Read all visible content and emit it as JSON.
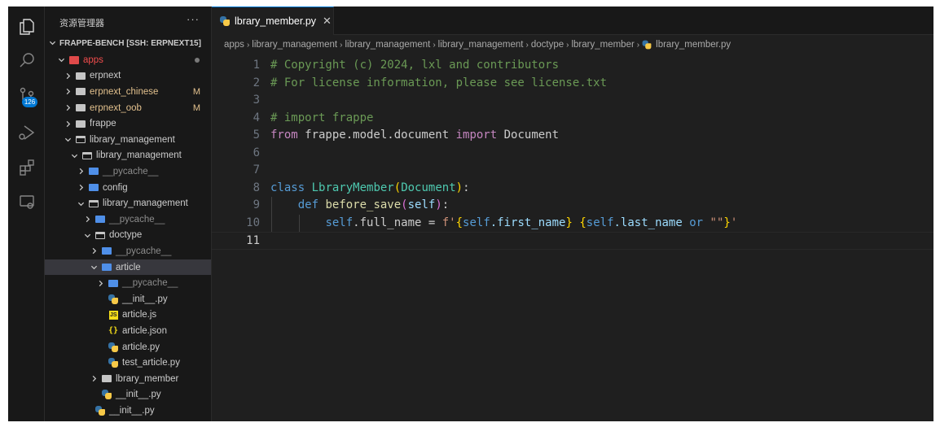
{
  "sidebar": {
    "title": "资源管理器",
    "more": "···",
    "workspace": "FRAPPE-BENCH [SSH: ERPNEXT15]",
    "tree": [
      {
        "label": "apps",
        "depth": 1,
        "kind": "apps",
        "open": true,
        "color": "red",
        "dot": true
      },
      {
        "label": "erpnext",
        "depth": 2,
        "kind": "folder",
        "open": false
      },
      {
        "label": "erpnext_chinese",
        "depth": 2,
        "kind": "folder",
        "open": false,
        "color": "modified",
        "status": "M"
      },
      {
        "label": "erpnext_oob",
        "depth": 2,
        "kind": "folder",
        "open": false,
        "color": "modified",
        "status": "M"
      },
      {
        "label": "frappe",
        "depth": 2,
        "kind": "folder",
        "open": false
      },
      {
        "label": "library_management",
        "depth": 2,
        "kind": "folder",
        "open": true
      },
      {
        "label": "library_management",
        "depth": 3,
        "kind": "folder",
        "open": true
      },
      {
        "label": "__pycache__",
        "depth": 4,
        "kind": "pyfolder",
        "open": false,
        "color": "dim"
      },
      {
        "label": "config",
        "depth": 4,
        "kind": "bluefolder",
        "open": false
      },
      {
        "label": "library_management",
        "depth": 4,
        "kind": "folder",
        "open": true
      },
      {
        "label": "__pycache__",
        "depth": 5,
        "kind": "pyfolder",
        "open": false,
        "color": "dim"
      },
      {
        "label": "doctype",
        "depth": 5,
        "kind": "folder",
        "open": true
      },
      {
        "label": "__pycache__",
        "depth": 6,
        "kind": "pyfolder",
        "open": false,
        "color": "dim"
      },
      {
        "label": "article",
        "depth": 6,
        "kind": "bluefolder",
        "open": true,
        "selected": true
      },
      {
        "label": "__pycache__",
        "depth": 7,
        "kind": "pyfolder",
        "open": false,
        "color": "dim"
      },
      {
        "label": "__init__.py",
        "depth": 7,
        "kind": "py",
        "file": true
      },
      {
        "label": "article.js",
        "depth": 7,
        "kind": "js",
        "file": true
      },
      {
        "label": "article.json",
        "depth": 7,
        "kind": "json",
        "file": true
      },
      {
        "label": "article.py",
        "depth": 7,
        "kind": "py",
        "file": true
      },
      {
        "label": "test_article.py",
        "depth": 7,
        "kind": "py",
        "file": true
      },
      {
        "label": "lbrary_member",
        "depth": 6,
        "kind": "folder",
        "open": false
      },
      {
        "label": "__init__.py",
        "depth": 6,
        "kind": "py",
        "file": true
      },
      {
        "label": "__init__.py",
        "depth": 5,
        "kind": "py",
        "file": true
      }
    ]
  },
  "activity_bar": {
    "scm_badge": "126",
    "icons": [
      "explorer-icon",
      "search-icon",
      "source-control-icon",
      "run-debug-icon",
      "extensions-icon",
      "remote-explorer-icon"
    ]
  },
  "editor": {
    "tab_label": "lbrary_member.py",
    "tab_close": "✕",
    "breadcrumb": [
      "apps",
      "library_management",
      "library_management",
      "library_management",
      "doctype",
      "lbrary_member",
      "lbrary_member.py"
    ],
    "current_line": 11,
    "lines": [
      [
        {
          "t": "# Copyright (c) 2024, lxl and contributors",
          "c": "comment"
        }
      ],
      [
        {
          "t": "# For license information, please see license.txt",
          "c": "comment"
        }
      ],
      [],
      [
        {
          "t": "# import frappe",
          "c": "comment"
        }
      ],
      [
        {
          "t": "from",
          "c": "control"
        },
        {
          "t": " frappe.model.document ",
          "c": "plain"
        },
        {
          "t": "import",
          "c": "control"
        },
        {
          "t": " Document",
          "c": "plain"
        }
      ],
      [],
      [],
      [
        {
          "t": "class",
          "c": "keyword"
        },
        {
          "t": " ",
          "c": "plain"
        },
        {
          "t": "LbraryMember",
          "c": "class"
        },
        {
          "t": "(",
          "c": "brace"
        },
        {
          "t": "Document",
          "c": "class"
        },
        {
          "t": ")",
          "c": "brace"
        },
        {
          "t": ":",
          "c": "plain"
        }
      ],
      [
        {
          "t": "    ",
          "c": "plain"
        },
        {
          "t": "def",
          "c": "keyword"
        },
        {
          "t": " ",
          "c": "plain"
        },
        {
          "t": "before_save",
          "c": "func"
        },
        {
          "t": "(",
          "c": "brace2"
        },
        {
          "t": "self",
          "c": "param"
        },
        {
          "t": ")",
          "c": "brace2"
        },
        {
          "t": ":",
          "c": "plain"
        }
      ],
      [
        {
          "t": "        ",
          "c": "plain"
        },
        {
          "t": "self",
          "c": "self"
        },
        {
          "t": ".full_name = ",
          "c": "plain"
        },
        {
          "t": "f'",
          "c": "str"
        },
        {
          "t": "{",
          "c": "brace"
        },
        {
          "t": "self",
          "c": "self"
        },
        {
          "t": ".first_name",
          "c": "param"
        },
        {
          "t": "}",
          "c": "brace"
        },
        {
          "t": " ",
          "c": "str"
        },
        {
          "t": "{",
          "c": "brace"
        },
        {
          "t": "self",
          "c": "self"
        },
        {
          "t": ".last_name ",
          "c": "param"
        },
        {
          "t": "or",
          "c": "keyword"
        },
        {
          "t": " ",
          "c": "plain"
        },
        {
          "t": "\"\"",
          "c": "str"
        },
        {
          "t": "}",
          "c": "brace"
        },
        {
          "t": "'",
          "c": "str"
        }
      ],
      []
    ]
  }
}
